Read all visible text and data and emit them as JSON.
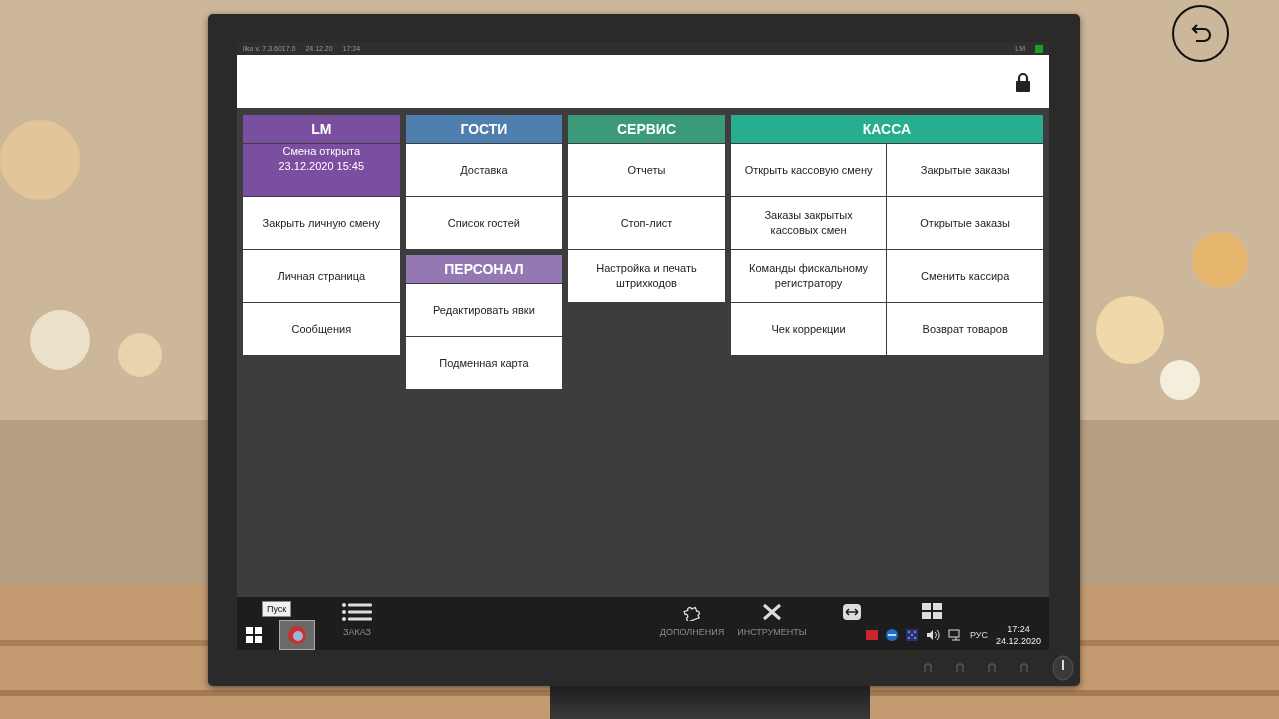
{
  "status_bar": {
    "version": "iiko v. 7.3.6017.0",
    "date": "24.12.20",
    "time": "17:24",
    "user": "LM",
    "online": true
  },
  "columns": [
    [
      {
        "title": "LM",
        "color": "#7b4fa0",
        "kind": "list",
        "items": [
          {
            "label": "Смена открыта\n23.12.2020 15:45",
            "kind": "status"
          },
          {
            "label": "Закрыть личную смену",
            "kind": "button"
          },
          {
            "label": "Личная страница",
            "kind": "button"
          },
          {
            "label": "Сообщения",
            "kind": "button"
          }
        ]
      }
    ],
    [
      {
        "title": "ГОСТИ",
        "color": "#4f7fae",
        "kind": "list",
        "items": [
          {
            "label": "Доставка",
            "kind": "button"
          },
          {
            "label": "Список гостей",
            "kind": "button"
          }
        ]
      },
      {
        "title": "ПЕРСОНАЛ",
        "color": "#9478b4",
        "kind": "list",
        "items": [
          {
            "label": "Редактировать явки",
            "kind": "button"
          },
          {
            "label": "Подменная карта",
            "kind": "button"
          }
        ]
      }
    ],
    [
      {
        "title": "СЕРВИС",
        "color": "#3a9a7a",
        "kind": "list",
        "items": [
          {
            "label": "Отчеты",
            "kind": "button"
          },
          {
            "label": "Стоп-лист",
            "kind": "button"
          },
          {
            "label": "Настройка и печать\nштрихкодов",
            "kind": "button"
          }
        ]
      }
    ],
    [
      {
        "title": "КАССА",
        "color": "#26ae8e",
        "kind": "grid",
        "items": [
          {
            "label": "Открыть кассовую смену",
            "kind": "button"
          },
          {
            "label": "Закрытые заказы",
            "kind": "button"
          },
          {
            "label": "Заказы закрытых\nкассовых смен",
            "kind": "button"
          },
          {
            "label": "Открытые заказы",
            "kind": "button"
          },
          {
            "label": "Команды фискальному\nрегистратору",
            "kind": "button"
          },
          {
            "label": "Сменить кассира",
            "kind": "button"
          },
          {
            "label": "Чек коррекции",
            "kind": "button"
          },
          {
            "label": "Возврат товаров",
            "kind": "button"
          }
        ]
      }
    ]
  ],
  "nav": [
    {
      "label": "ЗАКАЗ",
      "kind": "list"
    },
    {
      "kind": "gap"
    },
    {
      "label": "ДОПОЛНЕНИЯ",
      "kind": "puzzle"
    },
    {
      "label": "ИНСТРУМЕНТЫ",
      "kind": "tools"
    },
    {
      "kind": "remote"
    },
    {
      "kind": "windows"
    }
  ],
  "taskbar": {
    "tooltip": "Пуск",
    "apps": [
      {
        "selected": true
      }
    ],
    "language": "РУС",
    "time": "17:24",
    "date": "24.12.2020"
  }
}
